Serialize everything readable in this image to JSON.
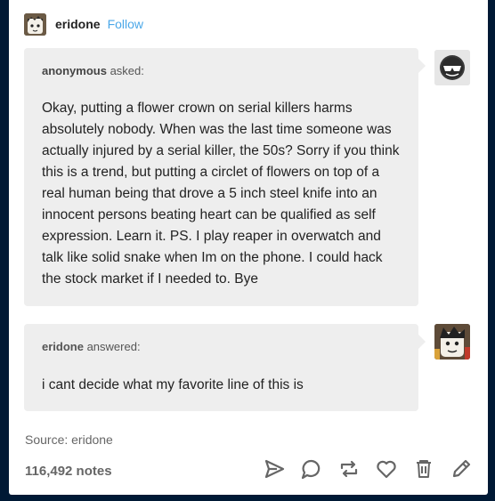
{
  "post": {
    "blog_name": "eridone",
    "follow_label": "Follow"
  },
  "ask": {
    "asker": "anonymous",
    "asked_suffix": " asked:",
    "text": "Okay, putting a flower crown on serial killers harms absolutely nobody. When was the last time someone was actually injured by a serial killer, the 50s? Sorry if you think this is a trend, but putting a circlet of flowers on top of a real human being that drove a 5 inch steel knife into an innocent persons beating heart can be qualified as self expression. Learn it. PS. I play reaper in overwatch and talk like solid snake when Im on the phone. I could hack the stock market if I needed to. Bye"
  },
  "answer": {
    "answerer": "eridone",
    "answered_suffix": " answered:",
    "text": "i cant decide what my favorite line of this is"
  },
  "footer": {
    "source_label": "Source: ",
    "source_value": "eridone",
    "notes": "116,492 notes"
  },
  "icons": [
    "share-icon",
    "reply-icon",
    "reblog-icon",
    "like-icon",
    "delete-icon",
    "edit-icon"
  ],
  "colors": {
    "accent": "#4aa7e8",
    "background": "#001935",
    "bubble": "#eeeeee",
    "icon": "#666666"
  }
}
